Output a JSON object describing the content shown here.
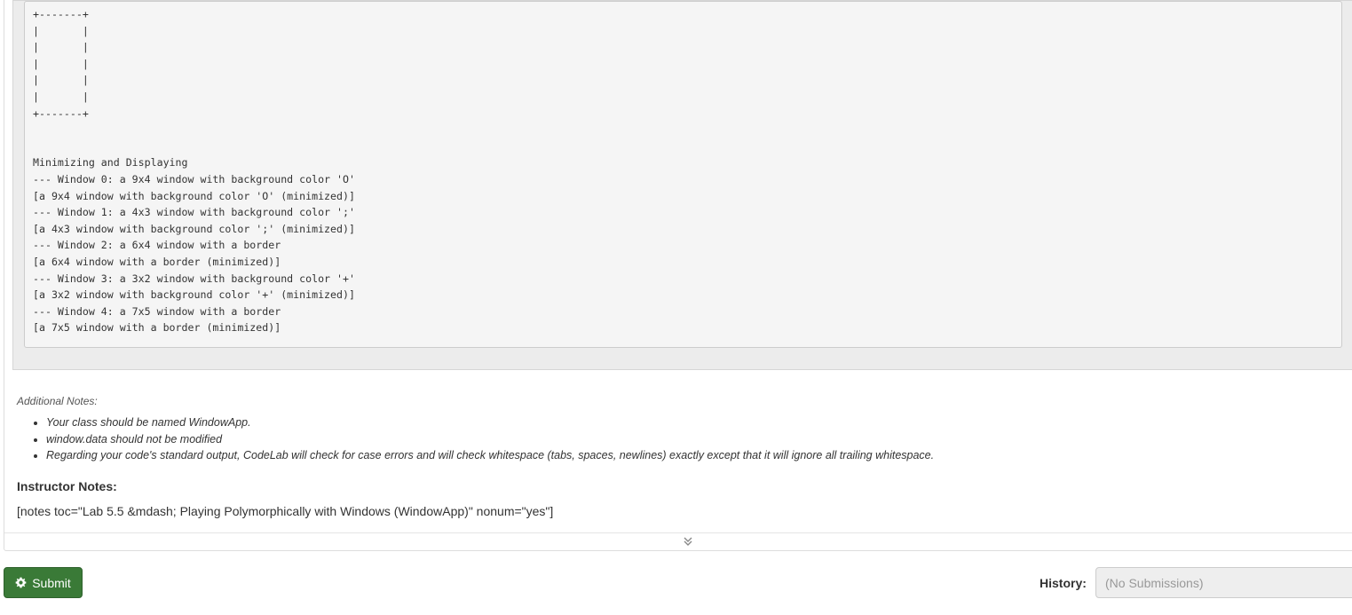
{
  "output": {
    "lines": [
      "--- Window 4: a 7x5 window with a border",
      "+-------+",
      "|       |",
      "|       |",
      "|       |",
      "|       |",
      "|       |",
      "+-------+",
      "",
      "",
      "Minimizing and Displaying",
      "--- Window 0: a 9x4 window with background color 'O'",
      "[a 9x4 window with background color 'O' (minimized)]",
      "--- Window 1: a 4x3 window with background color ';'",
      "[a 4x3 window with background color ';' (minimized)]",
      "--- Window 2: a 6x4 window with a border",
      "[a 6x4 window with a border (minimized)]",
      "--- Window 3: a 3x2 window with background color '+'",
      "[a 3x2 window with background color '+' (minimized)]",
      "--- Window 4: a 7x5 window with a border",
      "[a 7x5 window with a border (minimized)]"
    ]
  },
  "additional_notes": {
    "label": "Additional Notes:",
    "items": [
      "Your class should be named WindowApp.",
      "window.data should not be modified",
      "Regarding your code's standard output, CodeLab will check for case errors and will check whitespace (tabs, spaces, newlines) exactly except that it will ignore all trailing whitespace."
    ]
  },
  "instructor_notes": {
    "heading": "Instructor Notes:",
    "text": "[notes toc=\"Lab 5.5 &mdash; Playing Polymorphically with Windows (WindowApp)\" nonum=\"yes\"]"
  },
  "icons": {
    "expand": "double-chevron-down-icon",
    "submit": "gear-icon"
  },
  "colors": {
    "submit_bg": "#3a7a37",
    "output_bg": "#f5f5f5"
  },
  "footer": {
    "submit_label": "Submit",
    "history_label": "History:",
    "history_selected": "(No Submissions)"
  }
}
